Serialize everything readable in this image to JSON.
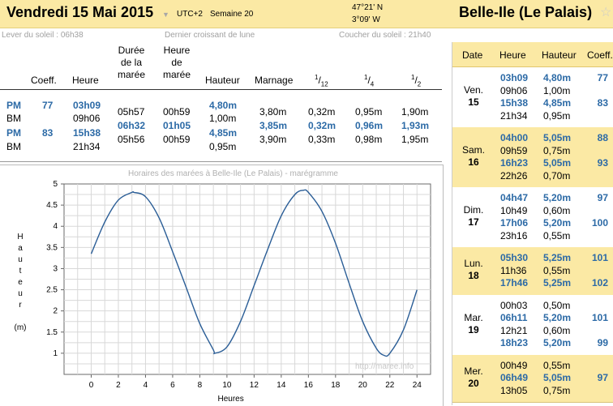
{
  "header": {
    "date_title": "Vendredi 15 Mai 2015",
    "timezone": "UTC+2",
    "week": "Semaine 20",
    "lat": "47°21' N",
    "lon": "3°09' W",
    "place": "Belle-Ile (Le Palais)"
  },
  "sun": {
    "sunrise": "Lever du soleil : 06h38",
    "moon": "Dernier croissant de lune",
    "sunset": "Coucher du soleil : 21h40"
  },
  "tide_table": {
    "headers": {
      "coeff": "Coeff.",
      "heure": "Heure",
      "duree": [
        "Durée",
        "de la",
        "marée"
      ],
      "heure_maree": [
        "Heure",
        "de",
        "marée"
      ],
      "hauteur": "Hauteur",
      "marnage": "Marnage",
      "f12": "12",
      "f4": "4",
      "f2": "2"
    },
    "rows": [
      {
        "type": "PM",
        "coeff": "77",
        "heure": "03h09",
        "duree": "",
        "hm": "",
        "hauteur": "4,80m",
        "marnage": "",
        "f12": "",
        "f4": "",
        "f2": ""
      },
      {
        "type": "BM",
        "coeff": "",
        "heure": "09h06",
        "duree": "05h57",
        "hm": "00h59",
        "hauteur": "1,00m",
        "marnage": "3,80m",
        "f12": "0,32m",
        "f4": "0,95m",
        "f2": "1,90m"
      },
      {
        "type": "PM",
        "coeff": "83",
        "heure": "15h38",
        "duree": "06h32",
        "hm": "01h05",
        "hauteur": "4,85m",
        "marnage": "3,85m",
        "f12": "0,32m",
        "f4": "0,96m",
        "f2": "1,93m"
      },
      {
        "type": "BM",
        "coeff": "",
        "heure": "21h34",
        "duree": "05h56",
        "hm": "00h59",
        "hauteur": "0,95m",
        "marnage": "3,90m",
        "f12": "0,33m",
        "f4": "0,98m",
        "f2": "1,95m"
      }
    ]
  },
  "chart_data": {
    "type": "line",
    "title": "Horaires des marées à Belle-Ile (Le Palais) - marégramme",
    "xlabel": "Heures",
    "ylabel": "Hauteur (m)",
    "ylabel_letters": [
      "H",
      "a",
      "u",
      "t",
      "e",
      "u",
      "r"
    ],
    "ylabel_unit": "(m)",
    "xlim": [
      -2,
      25
    ],
    "ylim": [
      0.5,
      5
    ],
    "x_ticks": [
      "0",
      "2",
      "4",
      "6",
      "8",
      "10",
      "12",
      "14",
      "16",
      "18",
      "20",
      "22",
      "24"
    ],
    "y_ticks": [
      "1",
      "1.5",
      "2",
      "2.5",
      "3",
      "3.5",
      "4",
      "4.5",
      "5"
    ],
    "grid": true,
    "x": [
      0,
      1,
      2,
      3,
      3.15,
      4,
      5,
      6,
      7,
      8,
      9,
      9.1,
      10,
      11,
      12,
      13,
      14,
      15,
      15.63,
      16,
      17,
      18,
      19,
      20,
      21,
      21.57,
      22,
      23,
      24
    ],
    "y": [
      3.35,
      4.1,
      4.62,
      4.8,
      4.8,
      4.7,
      4.2,
      3.4,
      2.55,
      1.7,
      1.08,
      1.0,
      1.15,
      1.75,
      2.6,
      3.45,
      4.25,
      4.75,
      4.85,
      4.8,
      4.35,
      3.6,
      2.65,
      1.75,
      1.12,
      0.95,
      1.0,
      1.55,
      2.5
    ]
  },
  "watermark": "http://maree.info",
  "right_panel": {
    "headers": {
      "date": "Date",
      "heure": "Heure",
      "hauteur": "Hauteur",
      "coeff": "Coeff."
    },
    "days": [
      {
        "name": "Ven.",
        "num": "15",
        "rows": [
          {
            "heure": "03h09",
            "hauteur": "4,80m",
            "coeff": "77",
            "pm": true
          },
          {
            "heure": "09h06",
            "hauteur": "1,00m",
            "coeff": "",
            "pm": false
          },
          {
            "heure": "15h38",
            "hauteur": "4,85m",
            "coeff": "83",
            "pm": true
          },
          {
            "heure": "21h34",
            "hauteur": "0,95m",
            "coeff": "",
            "pm": false
          }
        ]
      },
      {
        "name": "Sam.",
        "num": "16",
        "rows": [
          {
            "heure": "04h00",
            "hauteur": "5,05m",
            "coeff": "88",
            "pm": true
          },
          {
            "heure": "09h59",
            "hauteur": "0,75m",
            "coeff": "",
            "pm": false
          },
          {
            "heure": "16h23",
            "hauteur": "5,05m",
            "coeff": "93",
            "pm": true
          },
          {
            "heure": "22h26",
            "hauteur": "0,70m",
            "coeff": "",
            "pm": false
          }
        ]
      },
      {
        "name": "Dim.",
        "num": "17",
        "rows": [
          {
            "heure": "04h47",
            "hauteur": "5,20m",
            "coeff": "97",
            "pm": true
          },
          {
            "heure": "10h49",
            "hauteur": "0,60m",
            "coeff": "",
            "pm": false
          },
          {
            "heure": "17h06",
            "hauteur": "5,20m",
            "coeff": "100",
            "pm": true
          },
          {
            "heure": "23h16",
            "hauteur": "0,55m",
            "coeff": "",
            "pm": false
          }
        ]
      },
      {
        "name": "Lun.",
        "num": "18",
        "rows": [
          {
            "heure": "05h30",
            "hauteur": "5,25m",
            "coeff": "101",
            "pm": true
          },
          {
            "heure": "11h36",
            "hauteur": "0,55m",
            "coeff": "",
            "pm": false
          },
          {
            "heure": "17h46",
            "hauteur": "5,25m",
            "coeff": "102",
            "pm": true
          }
        ]
      },
      {
        "name": "Mar.",
        "num": "19",
        "rows": [
          {
            "heure": "00h03",
            "hauteur": "0,50m",
            "coeff": "",
            "pm": false
          },
          {
            "heure": "06h11",
            "hauteur": "5,20m",
            "coeff": "101",
            "pm": true
          },
          {
            "heure": "12h21",
            "hauteur": "0,60m",
            "coeff": "",
            "pm": false
          },
          {
            "heure": "18h23",
            "hauteur": "5,20m",
            "coeff": "99",
            "pm": true
          }
        ]
      },
      {
        "name": "Mer.",
        "num": "20",
        "rows": [
          {
            "heure": "00h49",
            "hauteur": "0,55m",
            "coeff": "",
            "pm": false
          },
          {
            "heure": "06h49",
            "hauteur": "5,05m",
            "coeff": "97",
            "pm": true
          },
          {
            "heure": "13h05",
            "hauteur": "0,75m",
            "coeff": "",
            "pm": false
          }
        ]
      }
    ]
  },
  "colors": {
    "accent_blue": "#2c6aa6",
    "header_yellow": "#fbe9a4",
    "curve": "#2a5d96"
  }
}
